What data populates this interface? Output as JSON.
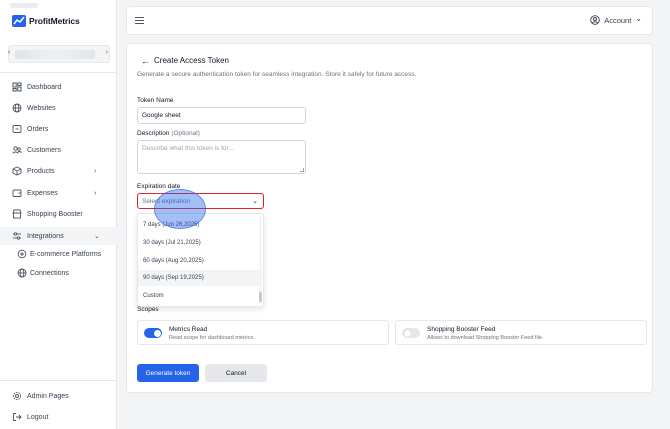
{
  "app": {
    "logo_text": "ProfitMetrics"
  },
  "sidebar": {
    "items": [
      {
        "label": "Dashboard",
        "icon": "grid-icon"
      },
      {
        "label": "Websites",
        "icon": "globe-icon"
      },
      {
        "label": "Orders",
        "icon": "box-icon"
      },
      {
        "label": "Customers",
        "icon": "users-icon"
      },
      {
        "label": "Products",
        "icon": "package-icon",
        "chevron": "›"
      },
      {
        "label": "Expenses",
        "icon": "wallet-icon",
        "chevron": "›"
      },
      {
        "label": "Shopping Booster",
        "icon": "storefront-icon"
      },
      {
        "label": "Integrations",
        "icon": "sliders-icon",
        "chevron": "⌄"
      },
      {
        "label": "E-commerce Platforms",
        "icon": "link-icon"
      },
      {
        "label": "Connections",
        "icon": "globe-icon"
      }
    ],
    "footer": [
      {
        "label": "Admin Pages",
        "icon": "gear-icon"
      },
      {
        "label": "Logout",
        "icon": "logout-icon"
      }
    ]
  },
  "header": {
    "account_label": "Account",
    "account_chevron": "⌄"
  },
  "form": {
    "back_arrow": "←",
    "title": "Create Access Token",
    "subtitle": "Generate a secure authentication token for seamless integration. Store it safely for future access.",
    "token_name_label": "Token Name",
    "token_name_value": "Google sheet",
    "description_label": "Description",
    "description_optional": "(Optional)",
    "description_placeholder": "Describe what this token is for...",
    "expiration_label": "Expiration date",
    "expiration_placeholder": "Select expiration",
    "expiration_options": [
      "7 days (Jun 26,2025)",
      "30 days (Jul 21,2025)",
      "60 days (Aug 20,2025)",
      "90 days (Sep 19,2025)",
      "Custom"
    ],
    "scopes_label": "Scopes",
    "scopes": [
      {
        "title": "Metrics Read",
        "desc": "Read scope for dashboard metrics.",
        "enabled": true
      },
      {
        "title": "Shopping Booster Feed",
        "desc": "Allows to download Shopping Booster Feed file.",
        "enabled": false
      }
    ],
    "generate_label": "Generate token",
    "cancel_label": "Cancel"
  },
  "colors": {
    "accent": "#2563eb",
    "error": "#dc2626"
  }
}
